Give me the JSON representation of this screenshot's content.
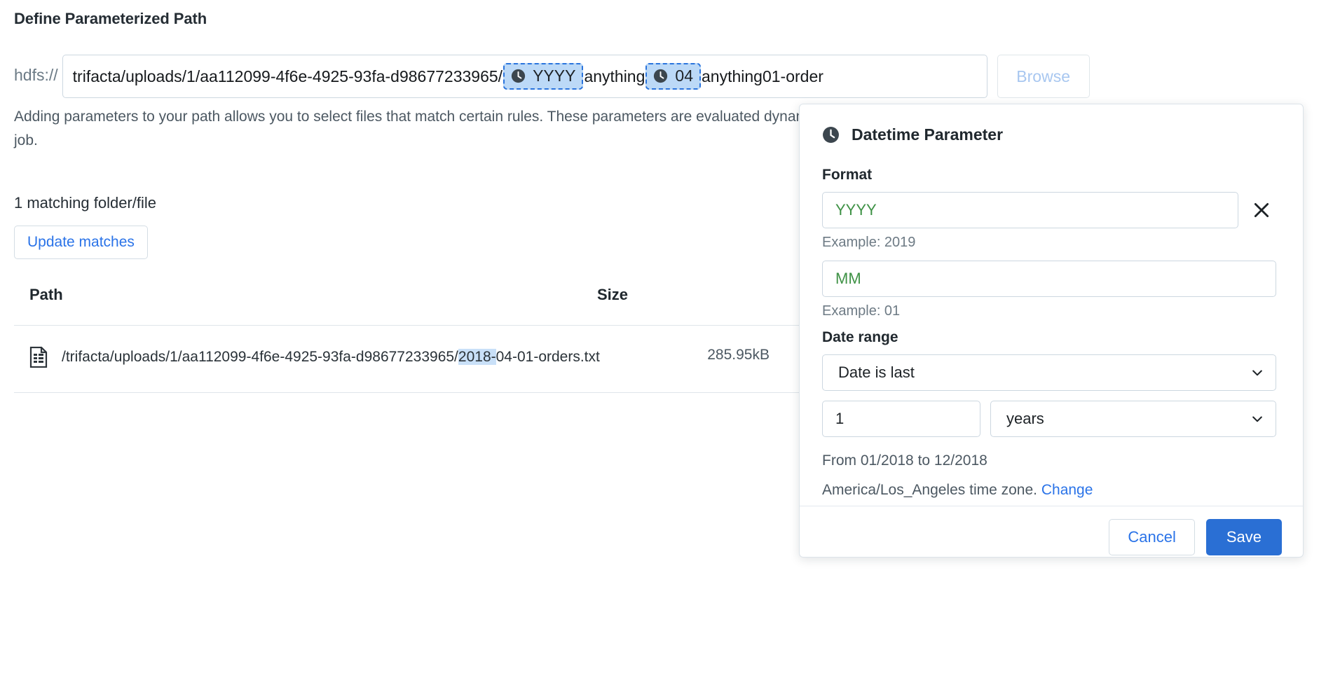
{
  "header": {
    "title": "Define Parameterized Path"
  },
  "path": {
    "scheme": "hdfs://",
    "prefix": "trifacta/uploads/1/aa112099-4f6e-4925-93fa-d98677233965/",
    "token1": {
      "icon": "clock-icon",
      "label": "YYYY"
    },
    "middle": "anything",
    "token2": {
      "icon": "clock-icon",
      "label": "04"
    },
    "suffix": "anything01-order",
    "browse_label": "Browse"
  },
  "description": "Adding parameters to your path allows you to select files that match certain rules. These parameters are evaluated dynamically each time you collect a sample or run a job.",
  "matches": {
    "count_label": "1 matching folder/file",
    "update_button": "Update matches",
    "columns": {
      "path": "Path",
      "size": "Size"
    },
    "rows": [
      {
        "icon": "file-icon",
        "path_plain_prefix": "/trifacta/uploads/1/aa112099-4f6e-4925-93fa-d98677233965/",
        "path_highlight": "2018-",
        "path_plain_suffix": "04-01-orders.txt",
        "size": "285.95kB"
      }
    ]
  },
  "popup": {
    "icon": "clock-icon",
    "title": "Datetime Parameter",
    "format_label": "Format",
    "format_value_1": "YYYY",
    "format_example_1": "Example: 2019",
    "format_value_2": "MM",
    "format_example_2": "Example: 01",
    "close_icon": "close-icon",
    "date_range_label": "Date range",
    "range_mode": "Date is last",
    "range_amount": "1",
    "range_unit": "years",
    "range_summary": "From 01/2018 to 12/2018",
    "timezone_text": "America/Los_Angeles time zone.",
    "timezone_change_link": "Change",
    "cancel_label": "Cancel",
    "save_label": "Save"
  },
  "colors": {
    "accent_blue": "#2a73e8",
    "save_blue": "#2a6fd4",
    "token_bg": "#bcd9f7",
    "token_border": "#2a74dd",
    "format_green": "#3f9246",
    "highlight": "#c9e0f8"
  }
}
